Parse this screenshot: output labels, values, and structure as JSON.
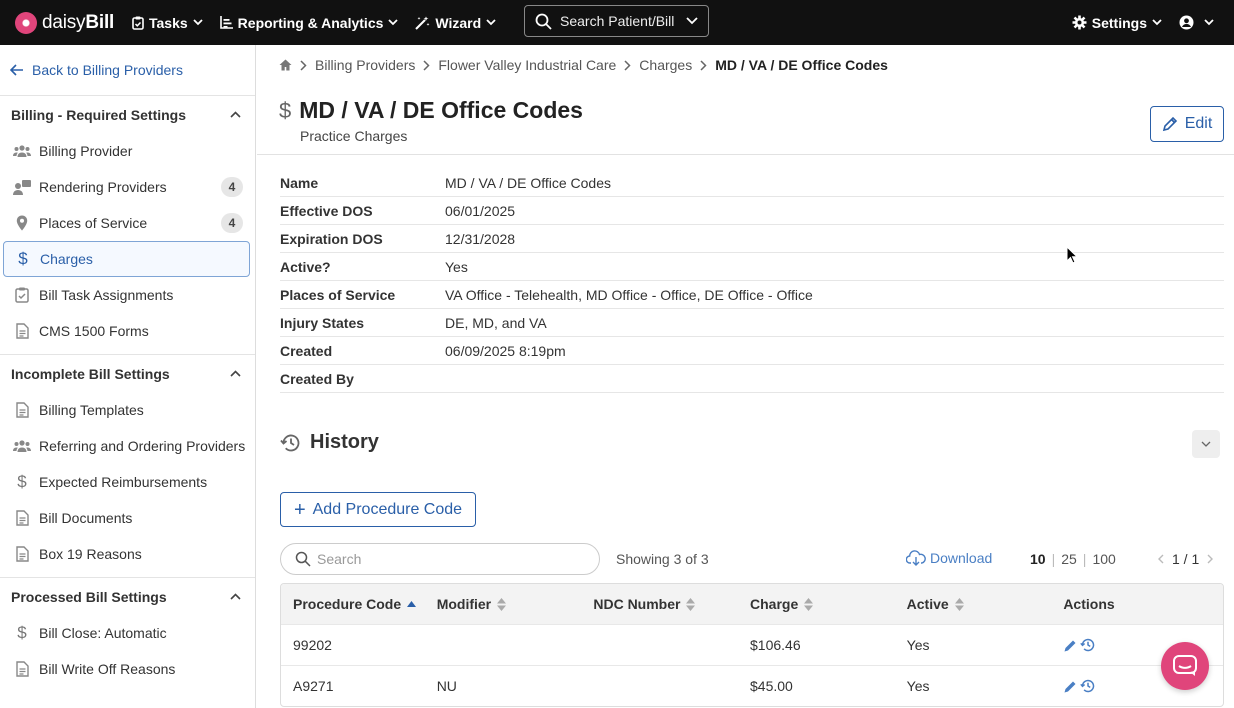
{
  "brand": {
    "name_light": "daisy",
    "name_bold": "Bill"
  },
  "nav": {
    "tasks": "Tasks",
    "reporting": "Reporting & Analytics",
    "wizard": "Wizard",
    "search": "Search Patient/Bill",
    "settings": "Settings"
  },
  "sidebar": {
    "back": "Back to Billing Providers",
    "sections": [
      {
        "title": "Billing - Required Settings",
        "items": [
          {
            "label": "Billing Provider",
            "icon": "users-icon"
          },
          {
            "label": "Rendering Providers",
            "icon": "provider-icon",
            "badge": "4"
          },
          {
            "label": "Places of Service",
            "icon": "map-pin-icon",
            "badge": "4"
          },
          {
            "label": "Charges",
            "icon": "dollar-icon"
          },
          {
            "label": "Bill Task Assignments",
            "icon": "clipboard-icon"
          },
          {
            "label": "CMS 1500 Forms",
            "icon": "document-icon"
          }
        ]
      },
      {
        "title": "Incomplete Bill Settings",
        "items": [
          {
            "label": "Billing Templates",
            "icon": "document-icon"
          },
          {
            "label": "Referring and Ordering Providers",
            "icon": "users-icon"
          },
          {
            "label": "Expected Reimbursements",
            "icon": "dollar-icon"
          },
          {
            "label": "Bill Documents",
            "icon": "document-icon"
          },
          {
            "label": "Box 19 Reasons",
            "icon": "document-icon"
          }
        ]
      },
      {
        "title": "Processed Bill Settings",
        "items": [
          {
            "label": "Bill Close: Automatic",
            "icon": "dollar-icon"
          },
          {
            "label": "Bill Write Off Reasons",
            "icon": "document-icon"
          }
        ]
      }
    ]
  },
  "breadcrumb": [
    "Billing Providers",
    "Flower Valley Industrial Care",
    "Charges",
    "MD / VA / DE Office Codes"
  ],
  "page": {
    "title": "MD / VA / DE Office Codes",
    "subtitle": "Practice Charges",
    "edit": "Edit"
  },
  "details": [
    {
      "k": "Name",
      "v": "MD / VA / DE Office Codes"
    },
    {
      "k": "Effective DOS",
      "v": "06/01/2025"
    },
    {
      "k": "Expiration DOS",
      "v": "12/31/2028"
    },
    {
      "k": "Active?",
      "v": "Yes"
    },
    {
      "k": "Places of Service",
      "v": "VA Office - Telehealth, MD Office - Office, DE Office - Office"
    },
    {
      "k": "Injury States",
      "v": "DE, MD, and VA"
    },
    {
      "k": "Created",
      "v": "06/09/2025 8:19pm"
    },
    {
      "k": "Created By",
      "v": ""
    }
  ],
  "history": {
    "title": "History"
  },
  "table_controls": {
    "add": "Add Procedure Code",
    "search_placeholder": "Search",
    "showing": "Showing 3 of 3",
    "download": "Download",
    "page_sizes": [
      "10",
      "25",
      "100"
    ],
    "page": "1 / 1"
  },
  "table": {
    "columns": [
      "Procedure Code",
      "Modifier",
      "NDC Number",
      "Charge",
      "Active",
      "Actions"
    ],
    "rows": [
      {
        "code": "99202",
        "modifier": "",
        "ndc": "",
        "charge": "$106.46",
        "active": "Yes"
      },
      {
        "code": "A9271",
        "modifier": "NU",
        "ndc": "",
        "charge": "$45.00",
        "active": "Yes"
      }
    ]
  },
  "colors": {
    "accent": "#2a5fa8",
    "brand": "#e0457b",
    "nav_bg": "#111111"
  }
}
